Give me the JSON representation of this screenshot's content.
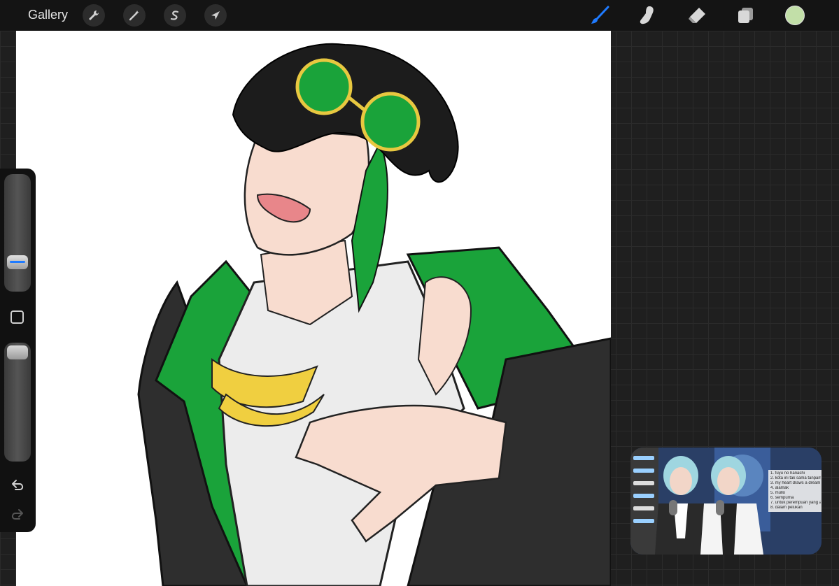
{
  "toolbar": {
    "gallery_label": "Gallery",
    "left_tools": [
      {
        "name": "actions",
        "icon": "wrench-icon"
      },
      {
        "name": "adjustments",
        "icon": "magic-wand-icon"
      },
      {
        "name": "selection",
        "icon": "s-curve-icon"
      },
      {
        "name": "transform",
        "icon": "arrow-cursor-icon"
      }
    ],
    "right_tools": [
      {
        "name": "brush",
        "icon": "brush-icon",
        "active": true
      },
      {
        "name": "smudge",
        "icon": "smudge-finger-icon"
      },
      {
        "name": "eraser",
        "icon": "eraser-icon"
      },
      {
        "name": "layers",
        "icon": "layers-icon"
      }
    ],
    "current_color": "#c2dfa8",
    "accent_color": "#1f7bff"
  },
  "sidebar": {
    "brush_size_level": 0.4,
    "opacity_level": 0.95,
    "undo_icon": "undo-arrow-icon",
    "redo_icon": "redo-arrow-icon",
    "modify_button_icon": "square-icon"
  },
  "canvas": {
    "background": "#ffffff",
    "artwork": "sketch-character"
  },
  "pip_video": {
    "lyrics": [
      "1. fuyu no hanashi",
      "2. kota ini tak sama tanpamu",
      "3. my heart draws a dream",
      "4. alamak",
      "5. mullo",
      "6. sempurna",
      "7. untuk perempuan yang ada",
      "8. dalam pelukan"
    ]
  }
}
